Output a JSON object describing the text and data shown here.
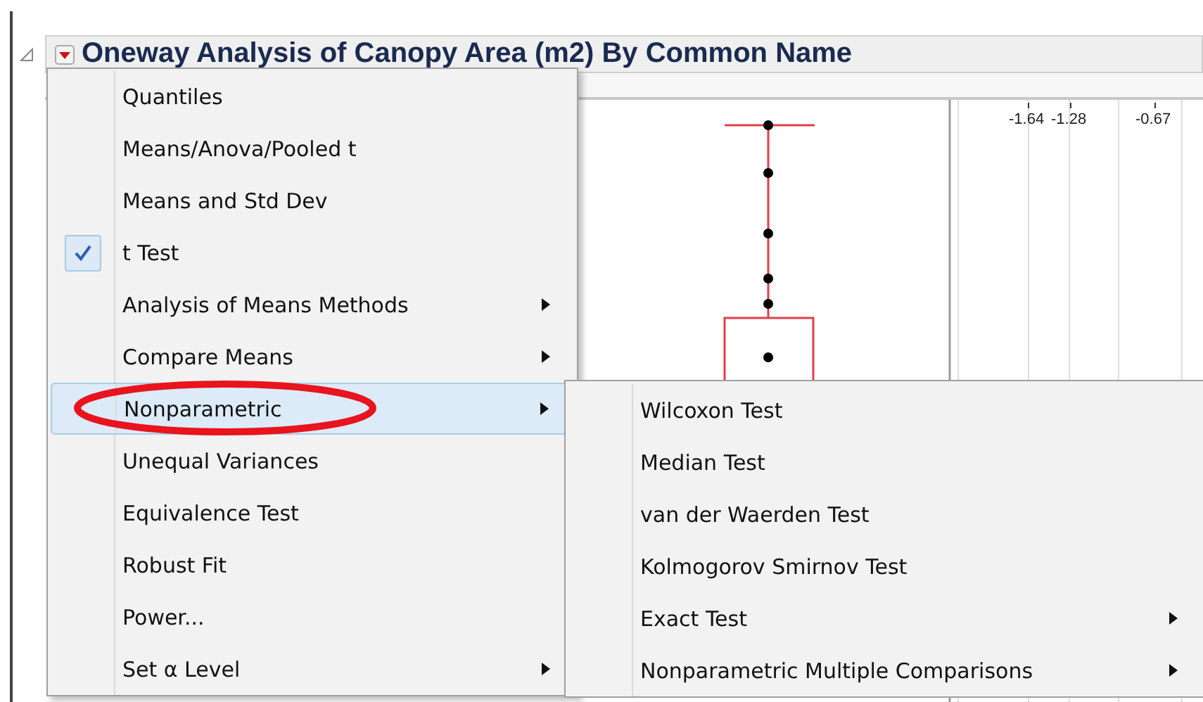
{
  "report": {
    "title": "Oneway Analysis of Canopy Area (m2) By Common Name",
    "expanded": true
  },
  "quantile_axis": {
    "ticks": [
      "-1.64",
      "-1.28",
      "-0.67"
    ]
  },
  "menu": {
    "items": [
      {
        "label": "Quantiles",
        "checked": false,
        "submenu": false,
        "highlighted": false,
        "circled": false
      },
      {
        "label": "Means/Anova/Pooled t",
        "checked": false,
        "submenu": false,
        "highlighted": false,
        "circled": false
      },
      {
        "label": "Means and Std Dev",
        "checked": false,
        "submenu": false,
        "highlighted": false,
        "circled": false
      },
      {
        "label": "t Test",
        "checked": true,
        "submenu": false,
        "highlighted": false,
        "circled": false
      },
      {
        "label": "Analysis of Means Methods",
        "checked": false,
        "submenu": true,
        "highlighted": false,
        "circled": false
      },
      {
        "label": "Compare Means",
        "checked": false,
        "submenu": true,
        "highlighted": false,
        "circled": false
      },
      {
        "label": "Nonparametric",
        "checked": false,
        "submenu": true,
        "highlighted": true,
        "circled": true
      },
      {
        "label": "Unequal Variances",
        "checked": false,
        "submenu": false,
        "highlighted": false,
        "circled": false
      },
      {
        "label": "Equivalence Test",
        "checked": false,
        "submenu": false,
        "highlighted": false,
        "circled": false
      },
      {
        "label": "Robust Fit",
        "checked": false,
        "submenu": false,
        "highlighted": false,
        "circled": false
      },
      {
        "label": "Power...",
        "checked": false,
        "submenu": false,
        "highlighted": false,
        "circled": false
      },
      {
        "label": "Set α Level",
        "checked": false,
        "submenu": true,
        "highlighted": false,
        "circled": false
      }
    ]
  },
  "submenu": {
    "items": [
      {
        "label": "Wilcoxon Test",
        "submenu": false
      },
      {
        "label": "Median Test",
        "submenu": false
      },
      {
        "label": "van der Waerden Test",
        "submenu": false
      },
      {
        "label": "Kolmogorov Smirnov Test",
        "submenu": false
      },
      {
        "label": "Exact Test",
        "submenu": true
      },
      {
        "label": "Nonparametric Multiple Comparisons",
        "submenu": true
      }
    ]
  }
}
